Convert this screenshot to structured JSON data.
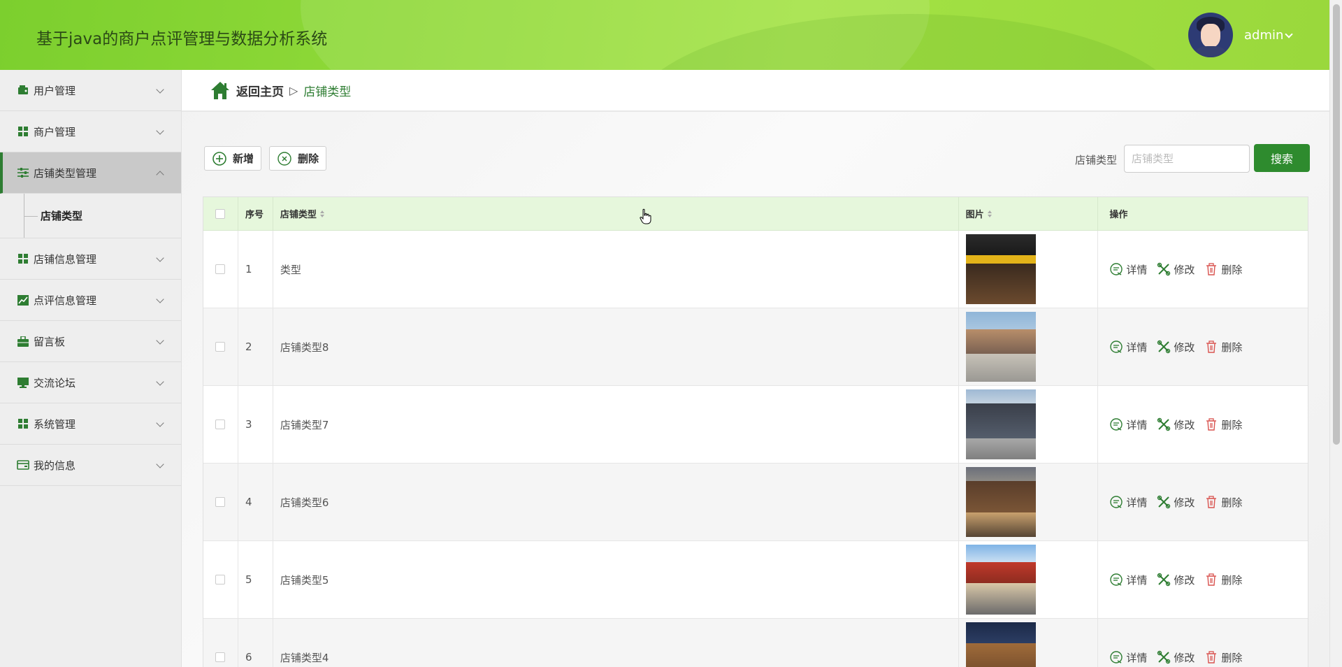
{
  "header": {
    "title": "基于java的商户点评管理与数据分析系统",
    "username": "admin"
  },
  "sidebar": {
    "items": [
      {
        "label": "用户管理",
        "icon": "wallet-icon"
      },
      {
        "label": "商户管理",
        "icon": "grid-icon"
      },
      {
        "label": "店铺类型管理",
        "icon": "sliders-icon",
        "active": true,
        "children": [
          {
            "label": "店铺类型"
          }
        ]
      },
      {
        "label": "店铺信息管理",
        "icon": "grid-icon"
      },
      {
        "label": "点评信息管理",
        "icon": "chart-icon"
      },
      {
        "label": "留言板",
        "icon": "briefcase-icon"
      },
      {
        "label": "交流论坛",
        "icon": "monitor-icon"
      },
      {
        "label": "系统管理",
        "icon": "grid-icon"
      },
      {
        "label": "我的信息",
        "icon": "card-icon"
      }
    ]
  },
  "breadcrumb": {
    "home": "返回主页",
    "separator": "▷",
    "current": "店铺类型"
  },
  "toolbar": {
    "add_label": "新增",
    "delete_label": "删除"
  },
  "search": {
    "label": "店铺类型",
    "placeholder": "店铺类型",
    "value": "",
    "button": "搜索"
  },
  "table": {
    "columns": {
      "index": "序号",
      "type": "店铺类型",
      "picture": "图片",
      "ops": "操作"
    },
    "ops": {
      "detail": "详情",
      "edit": "修改",
      "delete": "删除"
    },
    "rows": [
      {
        "index": "1",
        "type": "类型"
      },
      {
        "index": "2",
        "type": "店铺类型8"
      },
      {
        "index": "3",
        "type": "店铺类型7"
      },
      {
        "index": "4",
        "type": "店铺类型6"
      },
      {
        "index": "5",
        "type": "店铺类型5"
      },
      {
        "index": "6",
        "type": "店铺类型4"
      }
    ]
  },
  "colors": {
    "primary": "#2e8b2e",
    "header": "#9ad83c",
    "table_header": "#e6f7dc",
    "accent_text": "#2e7d32"
  }
}
